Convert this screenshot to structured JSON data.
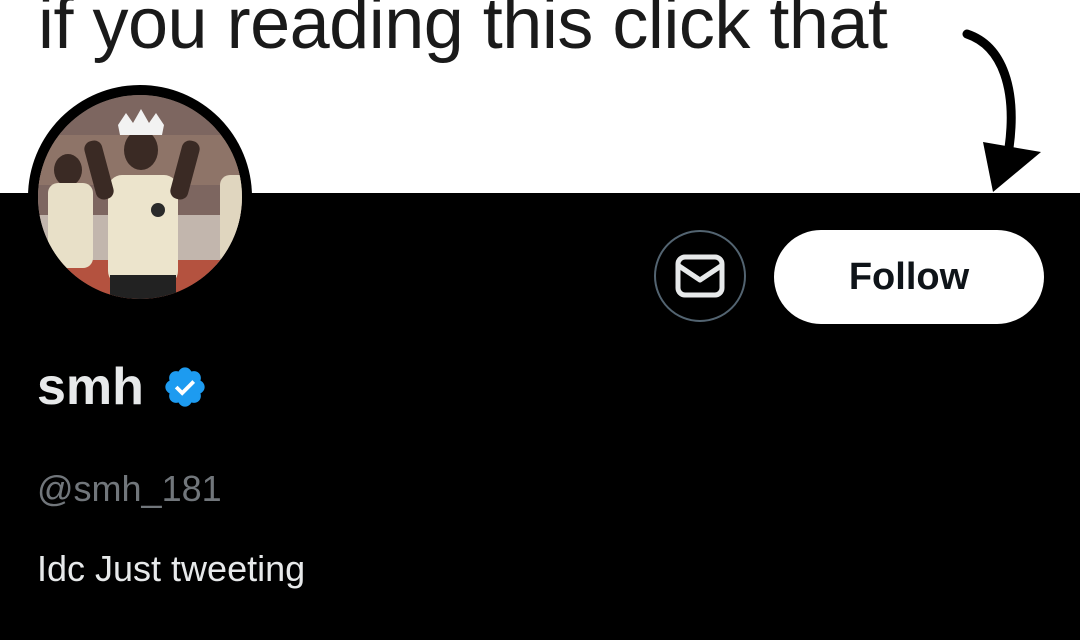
{
  "banner": {
    "caption": "if you reading this click that"
  },
  "profile": {
    "display_name": "smh",
    "handle": "@smh_181",
    "bio": "Idc Just tweeting",
    "verified": true
  },
  "actions": {
    "message_icon": "envelope-icon",
    "follow_label": "Follow"
  },
  "colors": {
    "background": "#000000",
    "banner_background": "#ffffff",
    "primary_text": "#e7e9ea",
    "secondary_text": "#71767b",
    "verified_badge": "#1d9bf0",
    "follow_button_bg": "#ffffff",
    "follow_button_text": "#0f1419",
    "outline_button_border": "#536471"
  }
}
